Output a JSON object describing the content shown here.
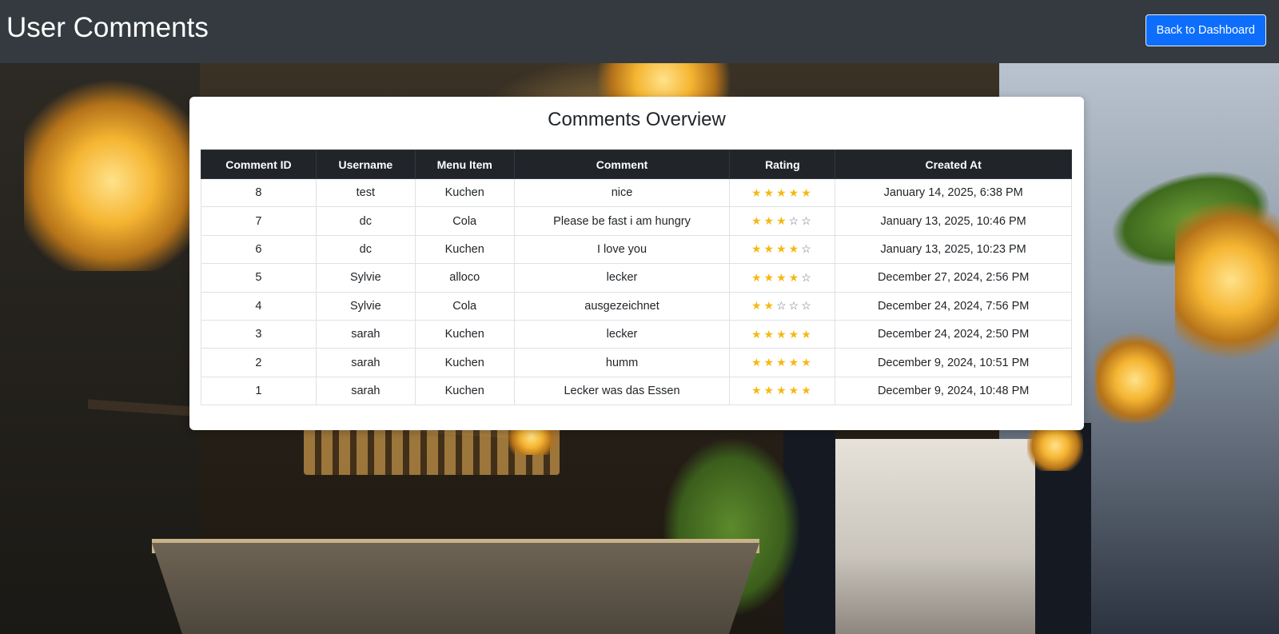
{
  "header": {
    "title": "User Comments",
    "back_button": "Back to Dashboard"
  },
  "card": {
    "title": "Comments Overview"
  },
  "table": {
    "columns": [
      "Comment ID",
      "Username",
      "Menu Item",
      "Comment",
      "Rating",
      "Created At"
    ],
    "rows": [
      {
        "id": "8",
        "username": "test",
        "menu_item": "Kuchen",
        "comment": "nice",
        "rating": 5,
        "created_at": "January 14, 2025, 6:38 PM"
      },
      {
        "id": "7",
        "username": "dc",
        "menu_item": "Cola",
        "comment": "Please be fast i am hungry",
        "rating": 3,
        "created_at": "January 13, 2025, 10:46 PM"
      },
      {
        "id": "6",
        "username": "dc",
        "menu_item": "Kuchen",
        "comment": "I love you",
        "rating": 4,
        "created_at": "January 13, 2025, 10:23 PM"
      },
      {
        "id": "5",
        "username": "Sylvie",
        "menu_item": "alloco",
        "comment": "lecker",
        "rating": 4,
        "created_at": "December 27, 2024, 2:56 PM"
      },
      {
        "id": "4",
        "username": "Sylvie",
        "menu_item": "Cola",
        "comment": "ausgezeichnet",
        "rating": 2,
        "created_at": "December 24, 2024, 7:56 PM"
      },
      {
        "id": "3",
        "username": "sarah",
        "menu_item": "Kuchen",
        "comment": "lecker",
        "rating": 5,
        "created_at": "December 24, 2024, 2:50 PM"
      },
      {
        "id": "2",
        "username": "sarah",
        "menu_item": "Kuchen",
        "comment": "humm",
        "rating": 5,
        "created_at": "December 9, 2024, 10:51 PM"
      },
      {
        "id": "1",
        "username": "sarah",
        "menu_item": "Kuchen",
        "comment": "Lecker was das Essen",
        "rating": 5,
        "created_at": "December 9, 2024, 10:48 PM"
      }
    ],
    "rating_max": 5
  },
  "colors": {
    "header_bg": "#343a40",
    "button_primary": "#0d6efd",
    "table_head_bg": "#212529",
    "star_filled": "#f5b914"
  },
  "icons": {
    "star_filled": "star-filled-icon",
    "star_empty": "star-empty-icon"
  }
}
